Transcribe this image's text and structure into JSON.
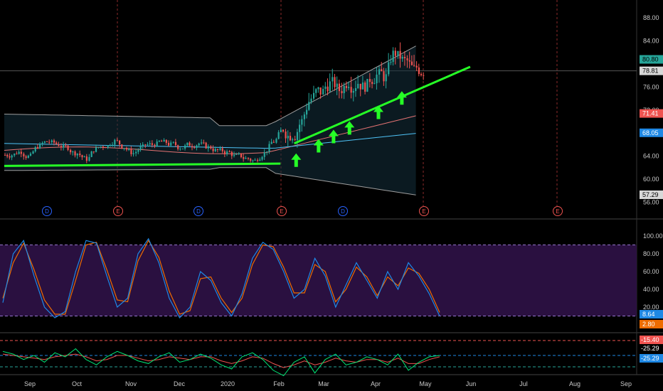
{
  "chart_data": {
    "type": "candlestick",
    "months": [
      "Sep",
      "Oct",
      "Nov",
      "Dec",
      "2020",
      "Feb",
      "Mar",
      "Apr",
      "May",
      "Jun",
      "Jul",
      "Aug",
      "Sep"
    ],
    "price_panel": {
      "yticks": [
        "88.00",
        "84.00",
        "76.00",
        "72.00",
        "68.00",
        "64.00",
        "60.00",
        "56.00"
      ],
      "last_price": "80.80",
      "price_tags": [
        {
          "label": "80.80",
          "value": 80.8,
          "color": "#26a69a",
          "text": "#000000"
        },
        {
          "label": "78.81",
          "value": 78.81,
          "color": "#d8d8d8",
          "text": "#000000"
        },
        {
          "label": "71.41",
          "value": 71.41,
          "color": "#ef5350",
          "text": "#ffffff"
        },
        {
          "label": "68.05",
          "value": 68.05,
          "color": "#1e88e5",
          "text": "#ffffff"
        },
        {
          "label": "57.29",
          "value": 57.29,
          "color": "#d8d8d8",
          "text": "#000000"
        }
      ],
      "events": [
        {
          "letter": "D",
          "color": "#2962ff",
          "week": 3
        },
        {
          "letter": "E",
          "color": "#ef5350",
          "week": 11
        },
        {
          "letter": "D",
          "color": "#2962ff",
          "week": 20
        },
        {
          "letter": "E",
          "color": "#ef5350",
          "week": 28
        },
        {
          "letter": "D",
          "color": "#2962ff",
          "week": 34
        },
        {
          "letter": "E",
          "color": "#ef5350",
          "week": 41
        },
        {
          "letter": "E",
          "color": "#ef5350",
          "week": 54
        }
      ],
      "support_line": {
        "from": [
          0,
          62.3
        ],
        "to": [
          28,
          62.7
        ],
        "color": "#26ff26"
      },
      "trend_line": {
        "from": [
          31,
          66.2
        ],
        "to": [
          46,
          80.0
        ],
        "color": "#26ff26"
      },
      "arrows": [
        {
          "week": 31.2,
          "value": 63.0
        },
        {
          "week": 33.6,
          "value": 65.5
        },
        {
          "week": 35.2,
          "value": 67.1
        },
        {
          "week": 36.9,
          "value": 68.6
        },
        {
          "week": 40.0,
          "value": 71.3
        },
        {
          "week": 42.5,
          "value": 73.8
        }
      ],
      "closes": [
        64.2,
        64.8,
        64.0,
        65.8,
        66.5,
        66.0,
        65.5,
        64.5,
        63.5,
        65.2,
        65.8,
        66.6,
        65.6,
        64.5,
        65.6,
        66.0,
        66.5,
        66.0,
        65.5,
        66.0,
        66.2,
        65.5,
        65.0,
        64.6,
        64.0,
        63.6,
        63.2,
        64.5,
        66.5,
        68.5,
        67.8,
        70.0,
        74.0,
        75.2,
        76.5,
        75.5,
        77.0,
        76.8,
        76.2,
        78.0,
        77.6,
        82.0,
        80.5,
        79.0,
        78.81
      ]
    },
    "stoch_panel": {
      "yticks": [
        "100.00",
        "80.00",
        "60.00",
        "40.00",
        "20.00"
      ],
      "tags": [
        {
          "label": "8.64",
          "value": 8.64,
          "color": "#1e88e5"
        },
        {
          "label": "2.80",
          "value": 2.8,
          "color": "#ef6c00"
        }
      ],
      "upper_band": 90,
      "lower_band": 10,
      "k": [
        25,
        80,
        95,
        55,
        20,
        8,
        15,
        60,
        95,
        92,
        55,
        20,
        30,
        80,
        97,
        70,
        30,
        8,
        20,
        60,
        50,
        25,
        10,
        35,
        75,
        93,
        85,
        60,
        30,
        40,
        75,
        55,
        20,
        45,
        70,
        50,
        30,
        60,
        40,
        70,
        55,
        35,
        10
      ],
      "d": [
        30,
        70,
        92,
        62,
        28,
        12,
        12,
        50,
        90,
        93,
        62,
        28,
        26,
        72,
        95,
        76,
        38,
        12,
        16,
        52,
        54,
        30,
        14,
        30,
        68,
        90,
        88,
        65,
        36,
        36,
        68,
        60,
        26,
        40,
        65,
        54,
        33,
        54,
        44,
        64,
        58,
        40,
        14
      ]
    },
    "osc_panel": {
      "tags": [
        {
          "label": "-15.40",
          "value": -15.4,
          "color": "#ef5350",
          "text": "#ffffff"
        },
        {
          "label": "-25.29",
          "value": -25.29,
          "color": "#000000",
          "text": "#ffffff"
        },
        {
          "label": "-25.29",
          "value": -25.29,
          "color": "#1e88e5",
          "text": "#ffffff"
        }
      ],
      "green": [
        -28,
        -26,
        -22,
        -25,
        -20,
        -27,
        -24,
        -30,
        -22,
        -18,
        -24,
        -28,
        -25,
        -21,
        -19,
        -24,
        -27,
        -20,
        -22,
        -26,
        -23,
        -18,
        -15,
        -24,
        -27,
        -22,
        -14,
        -10,
        -20,
        -24,
        -12,
        -22,
        -26,
        -18,
        -20,
        -24,
        -22,
        -18,
        -26,
        -14,
        -20,
        -24,
        -25
      ],
      "red": [
        -26,
        -25,
        -24,
        -23,
        -22,
        -24,
        -25,
        -26,
        -24,
        -21,
        -22,
        -25,
        -25,
        -23,
        -21,
        -22,
        -24,
        -23,
        -22,
        -24,
        -24,
        -21,
        -19,
        -21,
        -24,
        -23,
        -19,
        -16,
        -18,
        -21,
        -18,
        -20,
        -23,
        -21,
        -20,
        -22,
        -22,
        -20,
        -23,
        -19,
        -19,
        -22,
        -24
      ]
    }
  }
}
